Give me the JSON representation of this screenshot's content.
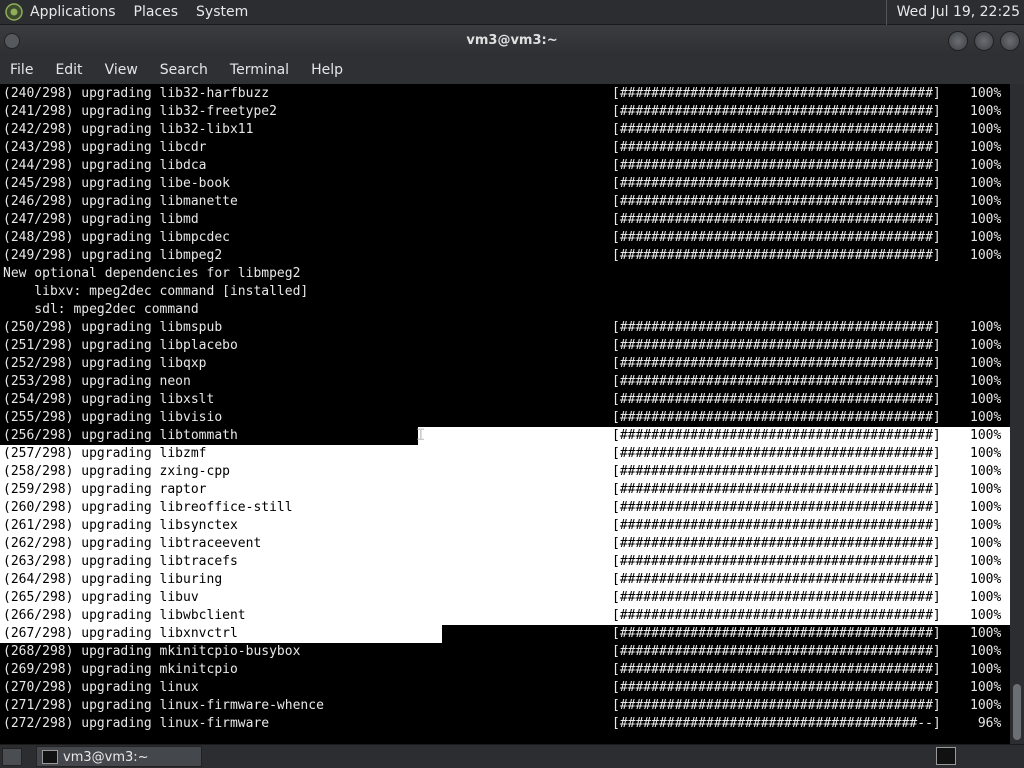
{
  "top_panel": {
    "menus": [
      "Applications",
      "Places",
      "System"
    ],
    "clock": "Wed Jul 19, 22:25"
  },
  "window": {
    "title": "vm3@vm3:~"
  },
  "menubar": [
    "File",
    "Edit",
    "View",
    "Search",
    "Terminal",
    "Help"
  ],
  "terminal": {
    "bar_full": "[########################################]",
    "bar_partial": "[######################################--]",
    "lines": [
      {
        "text": "(240/298) upgrading lib32-harfbuzz",
        "pct": "100%"
      },
      {
        "text": "(241/298) upgrading lib32-freetype2",
        "pct": "100%"
      },
      {
        "text": "(242/298) upgrading lib32-libx11",
        "pct": "100%"
      },
      {
        "text": "(243/298) upgrading libcdr",
        "pct": "100%"
      },
      {
        "text": "(244/298) upgrading libdca",
        "pct": "100%"
      },
      {
        "text": "(245/298) upgrading libe-book",
        "pct": "100%"
      },
      {
        "text": "(246/298) upgrading libmanette",
        "pct": "100%"
      },
      {
        "text": "(247/298) upgrading libmd",
        "pct": "100%"
      },
      {
        "text": "(248/298) upgrading libmpcdec",
        "pct": "100%"
      },
      {
        "text": "(249/298) upgrading libmpeg2",
        "pct": "100%"
      },
      {
        "text": "New optional dependencies for libmpeg2",
        "pct": ""
      },
      {
        "text": "    libxv: mpeg2dec command [installed]",
        "pct": ""
      },
      {
        "text": "    sdl: mpeg2dec command",
        "pct": ""
      },
      {
        "text": "(250/298) upgrading libmspub",
        "pct": "100%"
      },
      {
        "text": "(251/298) upgrading libplacebo",
        "pct": "100%"
      },
      {
        "text": "(252/298) upgrading libqxp",
        "pct": "100%"
      },
      {
        "text": "(253/298) upgrading neon",
        "pct": "100%"
      },
      {
        "text": "(254/298) upgrading libxslt",
        "pct": "100%"
      },
      {
        "text": "(255/298) upgrading libvisio",
        "pct": "100%"
      },
      {
        "text": "(256/298) upgrading libtommath",
        "pct": "100%"
      },
      {
        "text": "(257/298) upgrading libzmf",
        "pct": "100%"
      },
      {
        "text": "(258/298) upgrading zxing-cpp",
        "pct": "100%"
      },
      {
        "text": "(259/298) upgrading raptor",
        "pct": "100%"
      },
      {
        "text": "(260/298) upgrading libreoffice-still",
        "pct": "100%"
      },
      {
        "text": "(261/298) upgrading libsynctex",
        "pct": "100%"
      },
      {
        "text": "(262/298) upgrading libtraceevent",
        "pct": "100%"
      },
      {
        "text": "(263/298) upgrading libtracefs",
        "pct": "100%"
      },
      {
        "text": "(264/298) upgrading liburing",
        "pct": "100%"
      },
      {
        "text": "(265/298) upgrading libuv",
        "pct": "100%"
      },
      {
        "text": "(266/298) upgrading libwbclient",
        "pct": "100%"
      },
      {
        "text": "(267/298) upgrading libxnvctrl",
        "pct": "100%"
      },
      {
        "text": "(268/298) upgrading mkinitcpio-busybox",
        "pct": "100%"
      },
      {
        "text": "(269/298) upgrading mkinitcpio",
        "pct": "100%"
      },
      {
        "text": "(270/298) upgrading linux",
        "pct": "100%"
      },
      {
        "text": "(271/298) upgrading linux-firmware-whence",
        "pct": "100%"
      },
      {
        "text": "(272/298) upgrading linux-firmware",
        "pct": " 96%"
      }
    ]
  },
  "taskbar": {
    "task_label": "vm3@vm3:~"
  },
  "colors": {
    "panel_bg": "#2b2d30",
    "terminal_bg": "#000000",
    "terminal_fg": "#e8e8e8",
    "selection_bg": "#ffffff"
  },
  "icons": {
    "panel_logo": "distro-logo-icon",
    "taskbar_terminal": "terminal-icon",
    "tray": "terminal-icon"
  }
}
